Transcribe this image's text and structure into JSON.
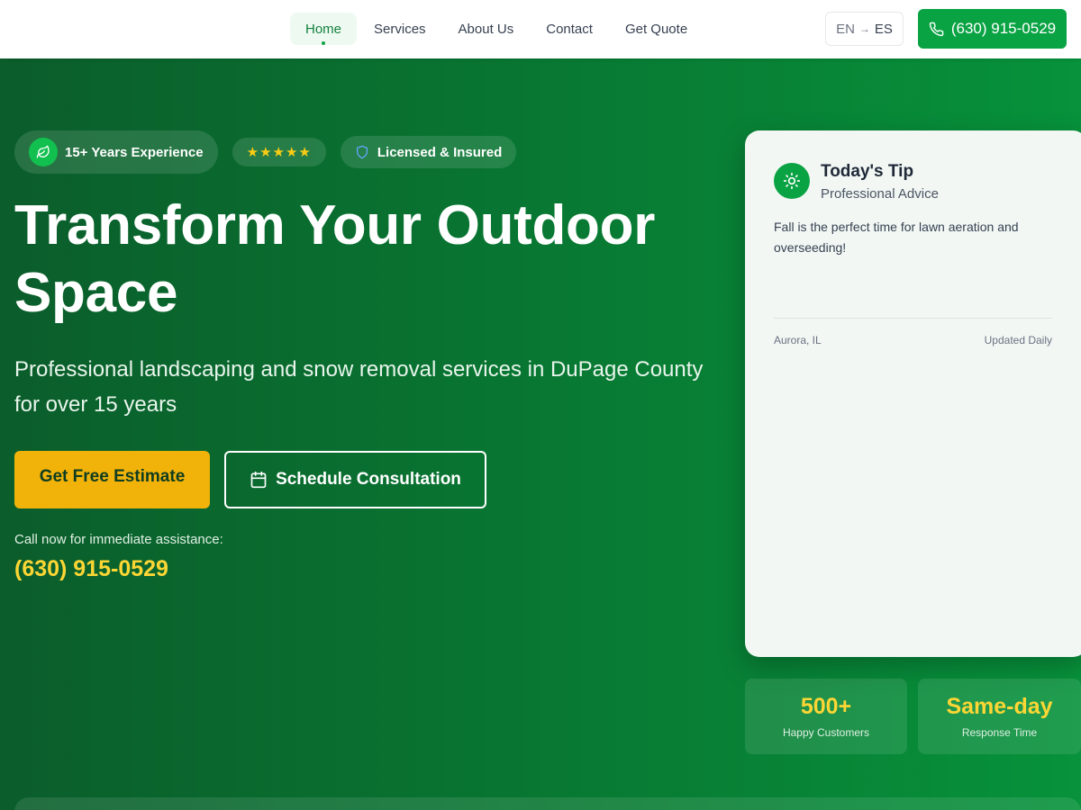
{
  "nav": {
    "items": [
      {
        "label": "Home",
        "active": true
      },
      {
        "label": "Services"
      },
      {
        "label": "About Us"
      },
      {
        "label": "Contact"
      },
      {
        "label": "Get Quote"
      }
    ]
  },
  "language": {
    "current": "EN",
    "arrow": "→",
    "target": "ES"
  },
  "header_phone": "(630) 915-0529",
  "badges": {
    "experience": "15+ Years Experience",
    "rating": {
      "stars": 5
    },
    "licensed": "Licensed & Insured"
  },
  "hero": {
    "headline": "Transform Your Outdoor Space",
    "subheadline": "Professional landscaping and snow removal services in DuPage County for over 15 years",
    "estimate_button": "Get Free Estimate",
    "schedule_button": "Schedule Consultation",
    "call_note": "Call now for immediate assistance:",
    "phone": "(630) 915-0529"
  },
  "tip": {
    "title": "Today's Tip",
    "subtitle": "Professional Advice",
    "body": "Fall is the perfect time for lawn aeration and overseeding!",
    "location": "Aurora, IL",
    "updated": "Updated Daily"
  },
  "stats": [
    {
      "value": "500+",
      "label": "Happy Customers"
    },
    {
      "value": "Same-day",
      "label": "Response Time"
    }
  ],
  "colors": {
    "brand_green": "#0aa344",
    "accent_yellow": "#f1b20a",
    "phone_yellow": "#fcd634",
    "hero_dark": "#0b5d2b"
  }
}
